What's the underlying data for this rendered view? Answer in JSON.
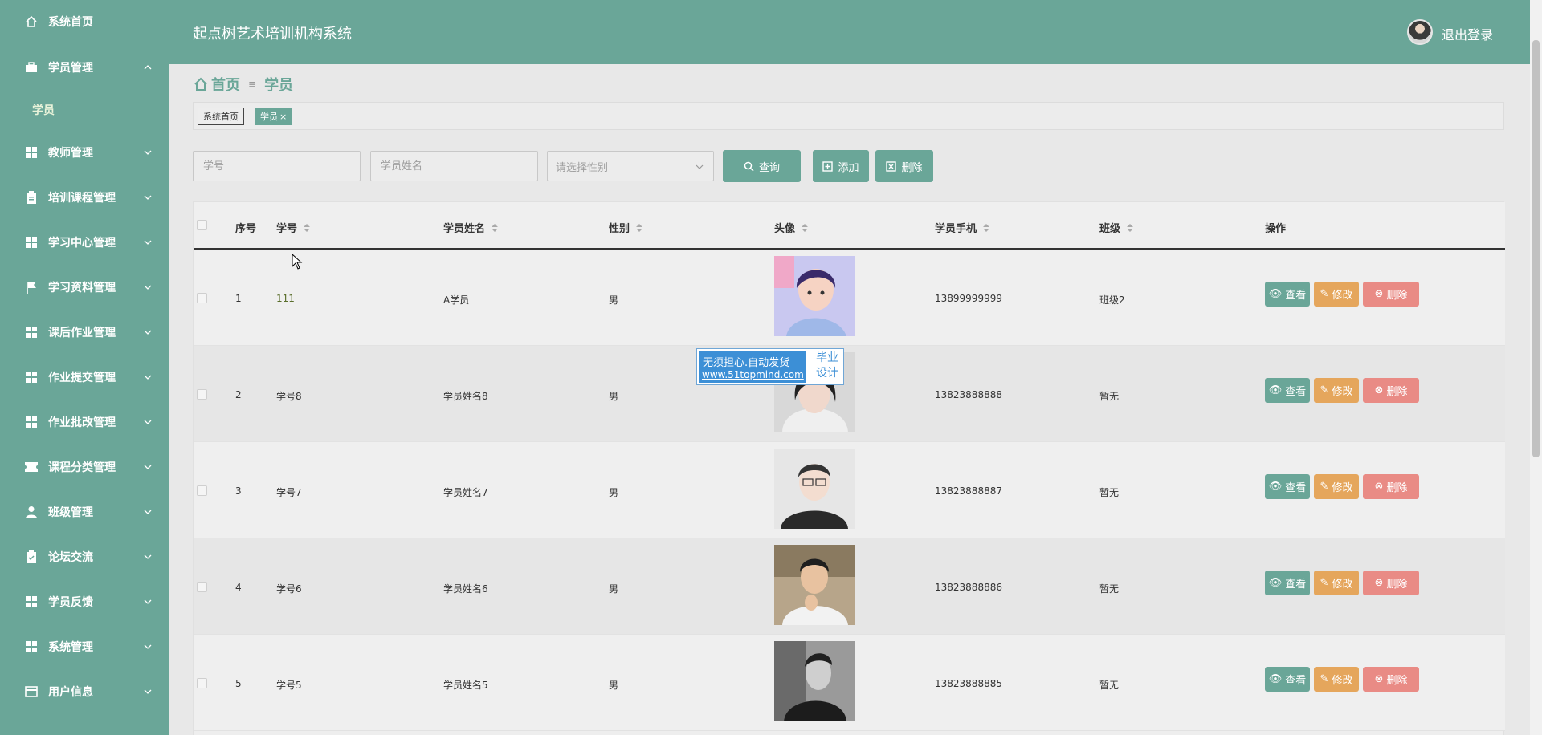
{
  "app": {
    "title": "起点树艺术培训机构系统",
    "logout": "退出登录"
  },
  "sidebar": {
    "items": [
      {
        "label": "系统首页",
        "icon": "home-icon"
      },
      {
        "label": "学员管理",
        "icon": "briefcase-icon",
        "expanded": true
      },
      {
        "label": "教师管理",
        "icon": "grid-icon"
      },
      {
        "label": "培训课程管理",
        "icon": "clipboard-icon"
      },
      {
        "label": "学习中心管理",
        "icon": "grid-icon"
      },
      {
        "label": "学习资料管理",
        "icon": "flag-icon"
      },
      {
        "label": "课后作业管理",
        "icon": "grid-icon"
      },
      {
        "label": "作业提交管理",
        "icon": "grid-icon"
      },
      {
        "label": "作业批改管理",
        "icon": "grid-icon"
      },
      {
        "label": "课程分类管理",
        "icon": "ticket-icon"
      },
      {
        "label": "班级管理",
        "icon": "user-icon"
      },
      {
        "label": "论坛交流",
        "icon": "clipboard-check-icon"
      },
      {
        "label": "学员反馈",
        "icon": "grid-icon"
      },
      {
        "label": "系统管理",
        "icon": "grid-icon"
      },
      {
        "label": "用户信息",
        "icon": "card-icon"
      }
    ],
    "sub_item": "学员"
  },
  "breadcrumb": {
    "home": "首页",
    "current": "学员"
  },
  "tags": {
    "home": "系统首页",
    "active": "学员"
  },
  "search": {
    "id_placeholder": "学号",
    "name_placeholder": "学员姓名",
    "gender_placeholder": "请选择性别",
    "query_label": "查询",
    "add_label": "添加",
    "delete_label": "删除"
  },
  "table": {
    "headers": [
      "序号",
      "学号",
      "学员姓名",
      "性别",
      "头像",
      "学员手机",
      "班级",
      "操作"
    ],
    "rows": [
      {
        "index": "1",
        "id": "111",
        "name": "A学员",
        "gender": "男",
        "phone": "13899999999",
        "class": "班级2"
      },
      {
        "index": "2",
        "id": "学号8",
        "name": "学员姓名8",
        "gender": "男",
        "phone": "13823888888",
        "class": "暂无"
      },
      {
        "index": "3",
        "id": "学号7",
        "name": "学员姓名7",
        "gender": "男",
        "phone": "13823888887",
        "class": "暂无"
      },
      {
        "index": "4",
        "id": "学号6",
        "name": "学员姓名6",
        "gender": "男",
        "phone": "13823888886",
        "class": "暂无"
      },
      {
        "index": "5",
        "id": "学号5",
        "name": "学员姓名5",
        "gender": "男",
        "phone": "13823888885",
        "class": "暂无"
      }
    ],
    "actions": {
      "view": "查看",
      "edit": "修改",
      "delete": "删除"
    }
  },
  "watermark": {
    "line1": "无须担心.自动发货",
    "line2": "www.51topmind.com",
    "right": "毕业设计"
  },
  "colors": {
    "primary": "#6aa698",
    "warning": "#e5a65c",
    "danger": "#e98b85",
    "background": "#e8e8e8"
  }
}
